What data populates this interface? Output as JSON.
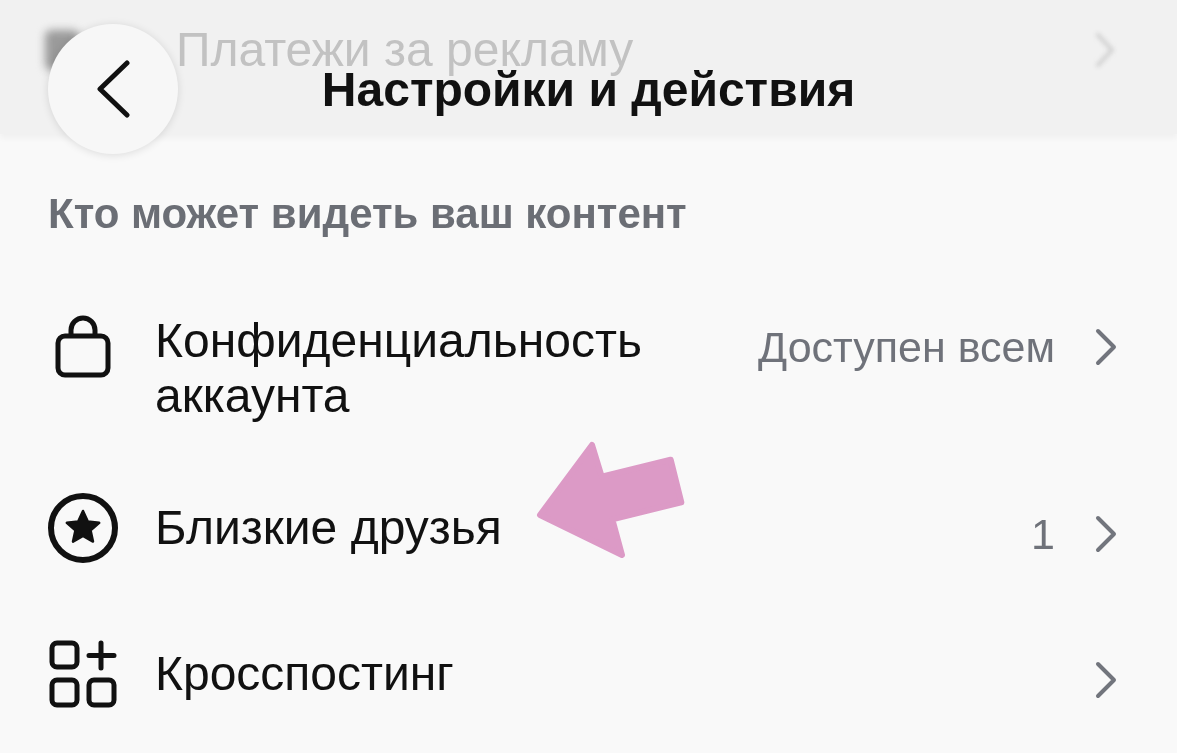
{
  "background_item": {
    "label": "Платежи за рекламу"
  },
  "header": {
    "title": "Настройки и действия"
  },
  "section": {
    "title": "Кто может видеть ваш контент",
    "items": [
      {
        "label": "Конфиденциальность аккаунта",
        "value": "Доступен всем",
        "marked": false
      },
      {
        "label": "Близкие друзья",
        "value": "1",
        "marked": true
      },
      {
        "label": "Кросспостинг",
        "marked": false
      }
    ]
  }
}
